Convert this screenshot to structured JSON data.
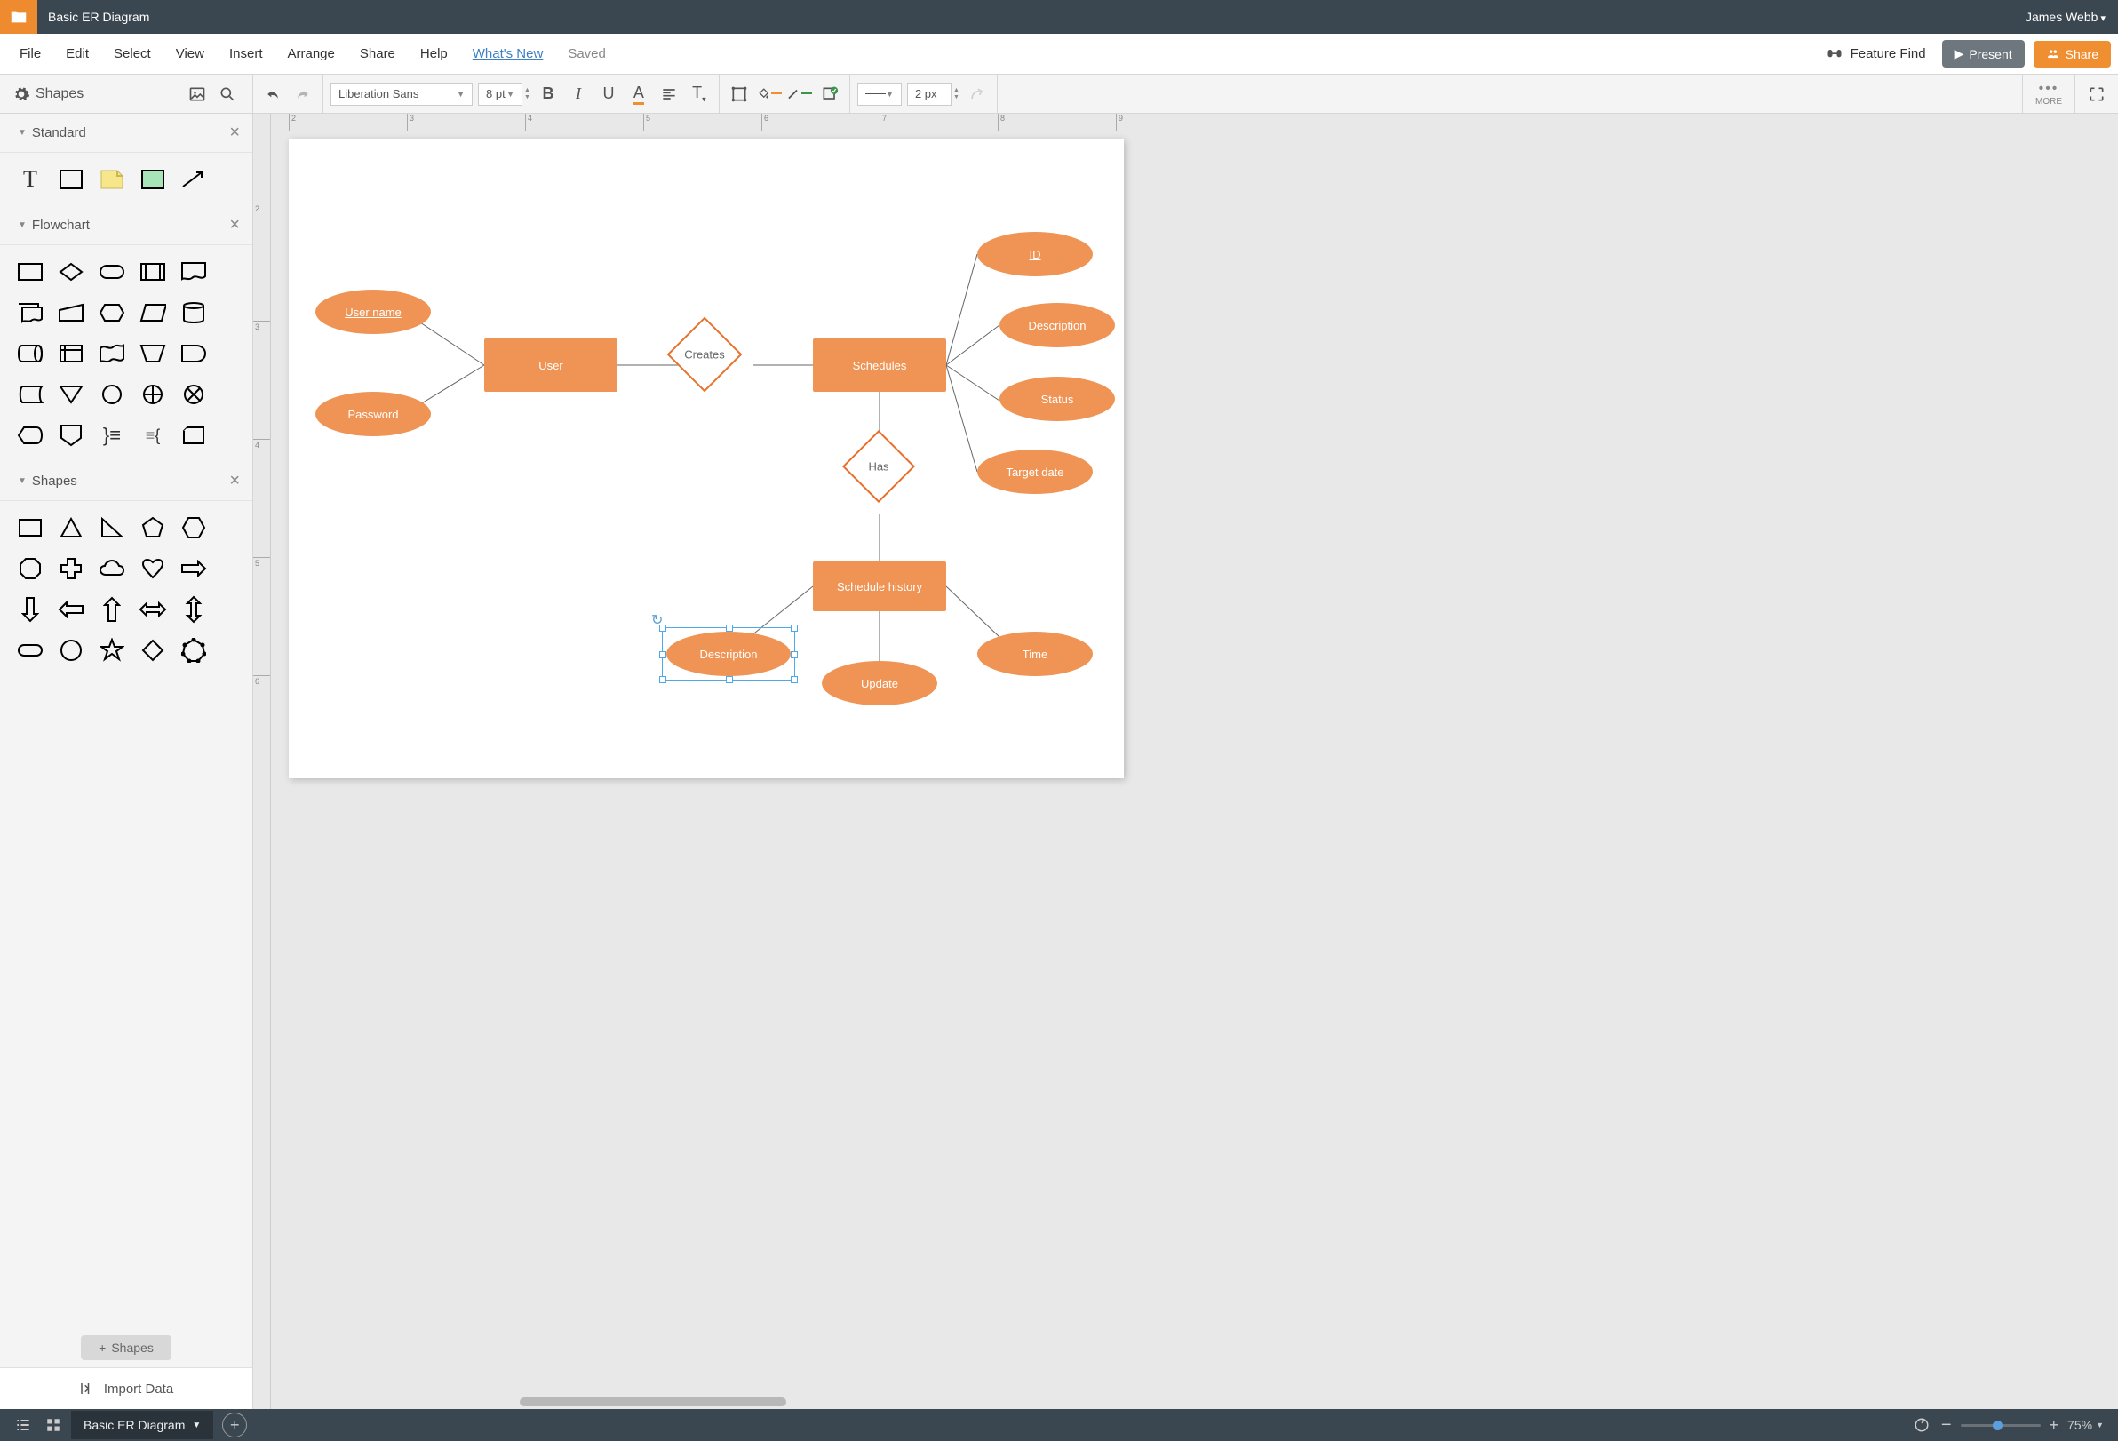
{
  "titlebar": {
    "title": "Basic ER Diagram",
    "user": "James Webb"
  },
  "menubar": {
    "items": [
      "File",
      "Edit",
      "Select",
      "View",
      "Insert",
      "Arrange",
      "Share",
      "Help"
    ],
    "whats_new": "What's New",
    "saved": "Saved",
    "feature_find": "Feature Find",
    "present": "Present",
    "share": "Share"
  },
  "toolbar": {
    "shapes_label": "Shapes",
    "font": "Liberation Sans",
    "font_size": "8 pt",
    "line_width": "2 px",
    "more_label": "MORE"
  },
  "palette": {
    "groups": [
      {
        "name": "Standard"
      },
      {
        "name": "Flowchart"
      },
      {
        "name": "Shapes"
      }
    ],
    "shapes_btn": "Shapes",
    "import_data": "Import Data"
  },
  "diagram": {
    "entities": {
      "user": "User",
      "schedules": "Schedules",
      "schedule_history": "Schedule history"
    },
    "relationships": {
      "creates": "Creates",
      "has": "Has"
    },
    "attributes": {
      "user_name": "User name",
      "password": "Password",
      "id": "ID",
      "description": "Description",
      "status": "Status",
      "target_date": "Target date",
      "history_description": "Description",
      "update": "Update",
      "time": "Time"
    }
  },
  "bottombar": {
    "tab": "Basic ER Diagram",
    "zoom": "75%"
  },
  "ruler_h": [
    "2",
    "3",
    "4",
    "5",
    "6",
    "7",
    "8",
    "9"
  ],
  "ruler_v": [
    "2",
    "3",
    "4",
    "5",
    "6"
  ]
}
